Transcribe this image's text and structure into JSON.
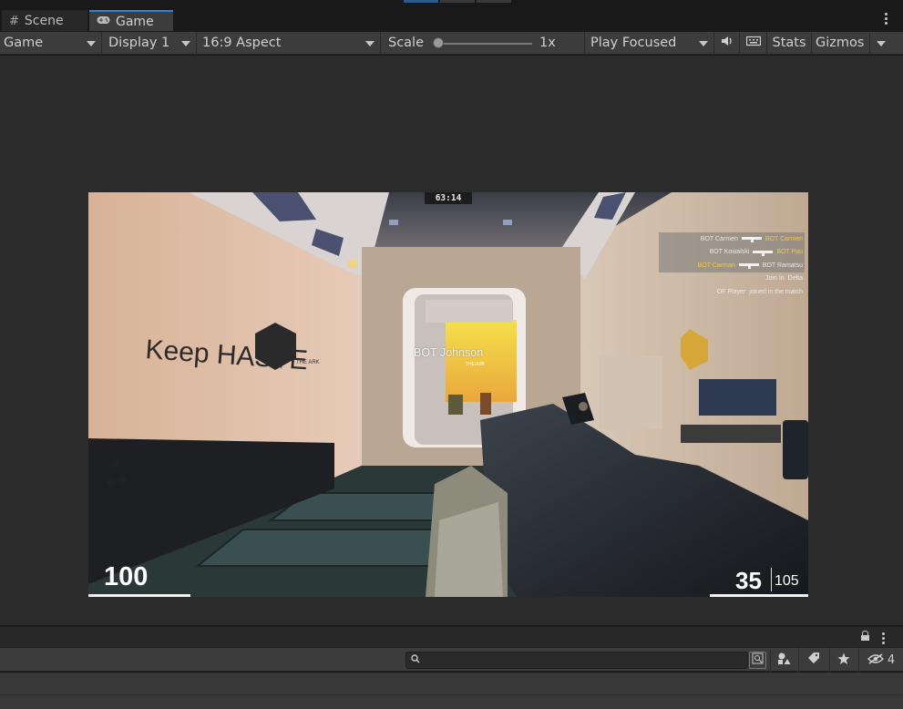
{
  "tabs": [
    {
      "label": "Scene",
      "icon": "grid-icon"
    },
    {
      "label": "Game",
      "icon": "gamepad-icon"
    }
  ],
  "toolbar": {
    "mode": "Game",
    "display": "Display 1",
    "aspect": "16:9 Aspect",
    "scale_label": "Scale",
    "scale_value": "1x",
    "scale_fraction": 0.0,
    "play_mode": "Play Focused",
    "stats": "Stats",
    "gizmos": "Gizmos"
  },
  "game": {
    "timer": "63:14",
    "target_name": "BOT Johnson",
    "health": "100",
    "ammo": "35",
    "reserve": "105",
    "wall_text": "Keep HASTE",
    "wall_brand": "THE ARK",
    "killfeed": [
      {
        "attacker": "BOT Carmen",
        "victim": "BOT Carmen"
      },
      {
        "attacker": "BOT Kowalski",
        "victim": "BOT Pau"
      },
      {
        "attacker": "BOT Carman",
        "victim": "BOT Ramatsu"
      }
    ],
    "messages": [
      {
        "user": "Join In",
        "name": "Delta"
      },
      {
        "user": "OF Player",
        "name": "joined in the match"
      }
    ]
  },
  "panel": {
    "search_placeholder": "",
    "hidden_count": "4"
  },
  "colors": {
    "accent": "#2f84d9",
    "killfeed_victim": "#f7c83a",
    "panel_bg": "#3c3c3c"
  }
}
